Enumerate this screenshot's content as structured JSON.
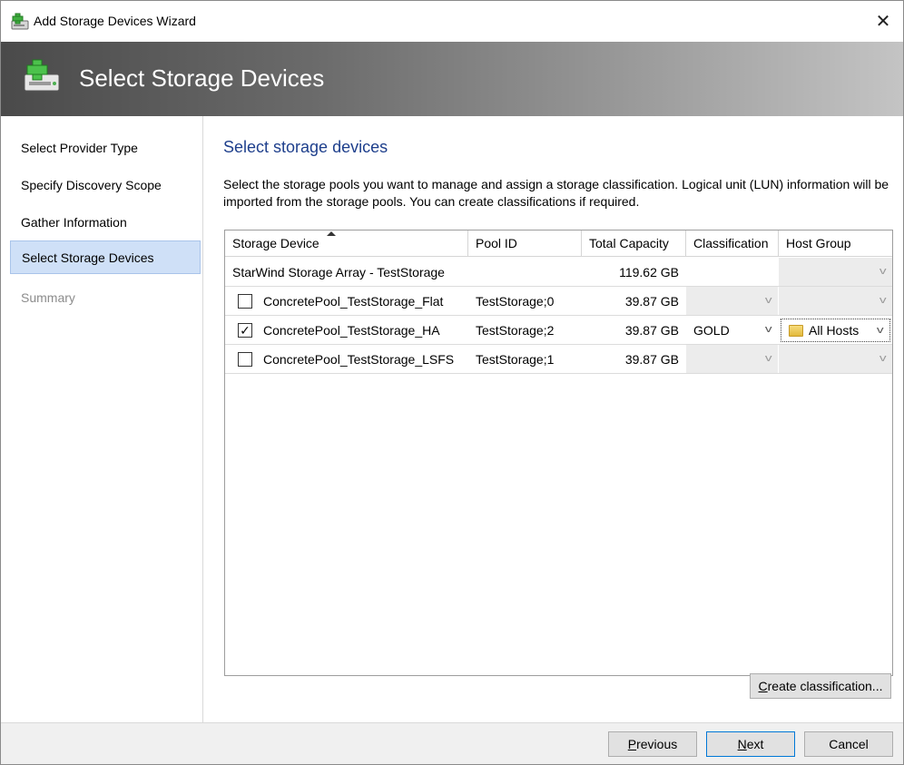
{
  "window": {
    "title": "Add Storage Devices Wizard",
    "close_glyph": "✕"
  },
  "banner": {
    "heading": "Select Storage Devices",
    "icon": "storage-add-icon"
  },
  "nav": {
    "items": [
      {
        "label": "Select Provider Type",
        "state": "normal"
      },
      {
        "label": "Specify Discovery Scope",
        "state": "normal"
      },
      {
        "label": "Gather Information",
        "state": "normal"
      },
      {
        "label": "Select Storage Devices",
        "state": "active"
      },
      {
        "label": "Summary",
        "state": "disabled"
      }
    ]
  },
  "main": {
    "section_title": "Select storage devices",
    "description": "Select the storage pools you want to manage and assign a storage classification. Logical unit (LUN) information will be imported from the storage pools.  You can create classifications if required."
  },
  "grid": {
    "columns": [
      "Storage Device",
      "Pool ID",
      "Total Capacity",
      "Classification",
      "Host Group"
    ],
    "sorted_column": "Storage Device",
    "array_row": {
      "device": "StarWind Storage Array - TestStorage",
      "capacity": "119.62 GB"
    },
    "pools": [
      {
        "device": "ConcretePool_TestStorage_Flat",
        "pool_id": "TestStorage;0",
        "capacity": "39.87 GB",
        "checked": false,
        "classification": "",
        "host_group": ""
      },
      {
        "device": "ConcretePool_TestStorage_HA",
        "pool_id": "TestStorage;2",
        "capacity": "39.87 GB",
        "checked": true,
        "classification": "GOLD",
        "host_group": "All Hosts"
      },
      {
        "device": "ConcretePool_TestStorage_LSFS",
        "pool_id": "TestStorage;1",
        "capacity": "39.87 GB",
        "checked": false,
        "classification": "",
        "host_group": ""
      }
    ],
    "check_glyph": "✓",
    "chevron_glyph": "v"
  },
  "buttons": {
    "create_classification": {
      "mnemonic": "C",
      "rest": "reate classification..."
    },
    "previous": {
      "mnemonic": "P",
      "rest": "revious"
    },
    "next": {
      "mnemonic": "N",
      "rest": "ext"
    },
    "cancel": "Cancel"
  },
  "colors": {
    "accent": "#1e3f8c",
    "nav_active": "#cfe0f7",
    "banner_dark": "#4a4a4a",
    "banner_light": "#c4c4c4"
  }
}
